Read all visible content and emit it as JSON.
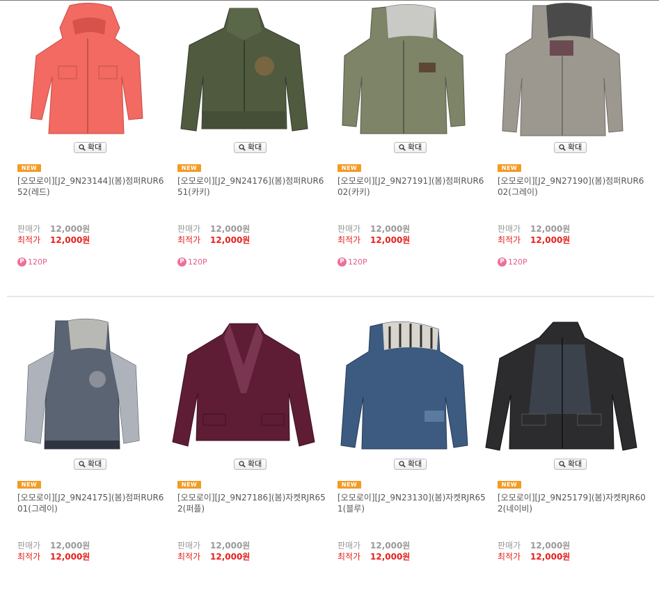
{
  "labels": {
    "zoom": "확대",
    "new_badge": "NEW",
    "sale_price": "판매가",
    "best_price": "최적가"
  },
  "colors": {
    "best_price": "#e4211f",
    "new_badge": "#f39b23",
    "points": "#ee6f9c"
  },
  "products": [
    {
      "name": "[오모로이][J2_9N23144](봄)점퍼RUR652(레드)",
      "sale_price": "12,000원",
      "best_price": "12,000원",
      "points": "120P",
      "image": "red-hooded-jacket",
      "color": "#f26a61"
    },
    {
      "name": "[오모로이][J2_9N24176](봄)점퍼RUR651(카키)",
      "sale_price": "12,000원",
      "best_price": "12,000원",
      "points": "120P",
      "image": "khaki-zip-jacket",
      "color": "#4f5a3f"
    },
    {
      "name": "[오모로이][J2_9N27191](봄)점퍼RUR602(카키)",
      "sale_price": "12,000원",
      "best_price": "12,000원",
      "points": "120P",
      "image": "khaki-hooded-jacket",
      "color": "#7d8468"
    },
    {
      "name": "[오모로이][J2_9N27190](봄)점퍼RUR602(그레이)",
      "sale_price": "12,000원",
      "best_price": "12,000원",
      "points": "120P",
      "image": "grey-hooded-jacket",
      "color": "#9c978f"
    },
    {
      "name": "[오모로이][J2_9N24175](봄)점퍼RUR601(그레이)",
      "sale_price": "12,000원",
      "best_price": "12,000원",
      "image": "grey-blue-hooded-jacket",
      "color": "#5b6472"
    },
    {
      "name": "[오모로이][J2_9N27186](봄)자켓RJR652(퍼플)",
      "sale_price": "12,000원",
      "best_price": "12,000원",
      "image": "purple-corduroy-blazer",
      "color": "#5e1c35"
    },
    {
      "name": "[오모로이][J2_9N23130](봄)자켓RJR651(블루)",
      "sale_price": "12,000원",
      "best_price": "12,000원",
      "image": "denim-hooded-jacket",
      "color": "#3d5b80"
    },
    {
      "name": "[오모로이][J2_9N25179](봄)자켓RJR602(네이비)",
      "sale_price": "12,000원",
      "best_price": "12,000원",
      "image": "black-denim-blazer",
      "color": "#2c2c2e"
    }
  ]
}
